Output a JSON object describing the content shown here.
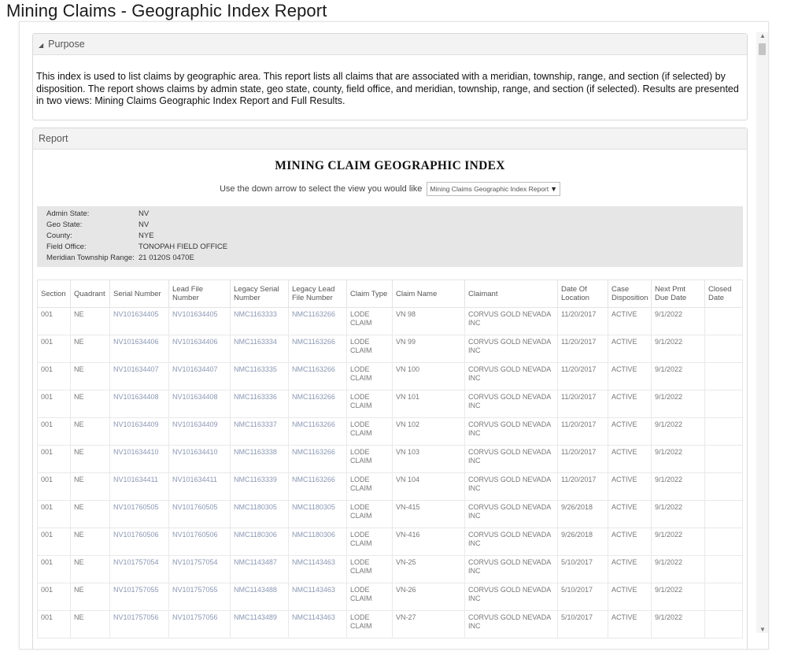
{
  "page_title": "Mining Claims - Geographic Index Report",
  "purpose": {
    "header": "Purpose",
    "text": "This index is used to list claims by geographic area. This report lists all claims that are associated with a meridian, township, range, and section (if selected) by disposition. The report shows claims by admin state, geo state, county, field office, and meridian, township, range, and section (if selected). Results are presented in two views: Mining Claims Geographic Index Report and Full Results."
  },
  "report": {
    "header": "Report",
    "title": "MINING CLAIM GEOGRAPHIC INDEX",
    "view_prompt": "Use the down arrow to select the view you would like",
    "view_selected": "Mining Claims Geographic Index Report",
    "info": [
      {
        "key": "Admin State:",
        "value": "NV"
      },
      {
        "key": "Geo State:",
        "value": "NV"
      },
      {
        "key": "County:",
        "value": "NYE"
      },
      {
        "key": "Field Office:",
        "value": "TONOPAH FIELD OFFICE"
      },
      {
        "key": "Meridian Township Range:",
        "value": "21 0120S 0470E"
      }
    ],
    "columns": [
      "Section",
      "Quadrant",
      "Serial Number",
      "Lead File Number",
      "Legacy Serial Number",
      "Legacy Lead File Number",
      "Claim Type",
      "Claim Name",
      "Claimant",
      "Date Of Location",
      "Case Disposition",
      "Next Pmt Due Date",
      "Closed Date"
    ],
    "rows": [
      [
        "001",
        "NE",
        "NV101634405",
        "NV101634405",
        "NMC1163333",
        "NMC1163266",
        "LODE CLAIM",
        "VN 98",
        "CORVUS GOLD NEVADA INC",
        "11/20/2017",
        "ACTIVE",
        "9/1/2022",
        ""
      ],
      [
        "001",
        "NE",
        "NV101634406",
        "NV101634406",
        "NMC1163334",
        "NMC1163266",
        "LODE CLAIM",
        "VN 99",
        "CORVUS GOLD NEVADA INC",
        "11/20/2017",
        "ACTIVE",
        "9/1/2022",
        ""
      ],
      [
        "001",
        "NE",
        "NV101634407",
        "NV101634407",
        "NMC1163335",
        "NMC1163266",
        "LODE CLAIM",
        "VN 100",
        "CORVUS GOLD NEVADA INC",
        "11/20/2017",
        "ACTIVE",
        "9/1/2022",
        ""
      ],
      [
        "001",
        "NE",
        "NV101634408",
        "NV101634408",
        "NMC1163336",
        "NMC1163266",
        "LODE CLAIM",
        "VN 101",
        "CORVUS GOLD NEVADA INC",
        "11/20/2017",
        "ACTIVE",
        "9/1/2022",
        ""
      ],
      [
        "001",
        "NE",
        "NV101634409",
        "NV101634409",
        "NMC1163337",
        "NMC1163266",
        "LODE CLAIM",
        "VN 102",
        "CORVUS GOLD NEVADA INC",
        "11/20/2017",
        "ACTIVE",
        "9/1/2022",
        ""
      ],
      [
        "001",
        "NE",
        "NV101634410",
        "NV101634410",
        "NMC1163338",
        "NMC1163266",
        "LODE CLAIM",
        "VN 103",
        "CORVUS GOLD NEVADA INC",
        "11/20/2017",
        "ACTIVE",
        "9/1/2022",
        ""
      ],
      [
        "001",
        "NE",
        "NV101634411",
        "NV101634411",
        "NMC1163339",
        "NMC1163266",
        "LODE CLAIM",
        "VN 104",
        "CORVUS GOLD NEVADA INC",
        "11/20/2017",
        "ACTIVE",
        "9/1/2022",
        ""
      ],
      [
        "001",
        "NE",
        "NV101760505",
        "NV101760505",
        "NMC1180305",
        "NMC1180305",
        "LODE CLAIM",
        "VN-415",
        "CORVUS GOLD NEVADA INC",
        "9/26/2018",
        "ACTIVE",
        "9/1/2022",
        ""
      ],
      [
        "001",
        "NE",
        "NV101760506",
        "NV101760506",
        "NMC1180306",
        "NMC1180306",
        "LODE CLAIM",
        "VN-416",
        "CORVUS GOLD NEVADA INC",
        "9/26/2018",
        "ACTIVE",
        "9/1/2022",
        ""
      ],
      [
        "001",
        "NE",
        "NV101757054",
        "NV101757054",
        "NMC1143487",
        "NMC1143463",
        "LODE CLAIM",
        "VN-25",
        "CORVUS GOLD NEVADA INC",
        "5/10/2017",
        "ACTIVE",
        "9/1/2022",
        ""
      ],
      [
        "001",
        "NE",
        "NV101757055",
        "NV101757055",
        "NMC1143488",
        "NMC1143463",
        "LODE CLAIM",
        "VN-26",
        "CORVUS GOLD NEVADA INC",
        "5/10/2017",
        "ACTIVE",
        "9/1/2022",
        ""
      ],
      [
        "001",
        "NE",
        "NV101757056",
        "NV101757056",
        "NMC1143489",
        "NMC1143463",
        "LODE CLAIM",
        "VN-27",
        "CORVUS GOLD NEVADA INC",
        "5/10/2017",
        "ACTIVE",
        "9/1/2022",
        ""
      ]
    ]
  },
  "icons": {
    "collapse": "triangle-collapse-icon",
    "dropdown": "down-arrow-icon",
    "scroll_up": "scroll-up-icon",
    "scroll_down": "scroll-down-icon"
  }
}
